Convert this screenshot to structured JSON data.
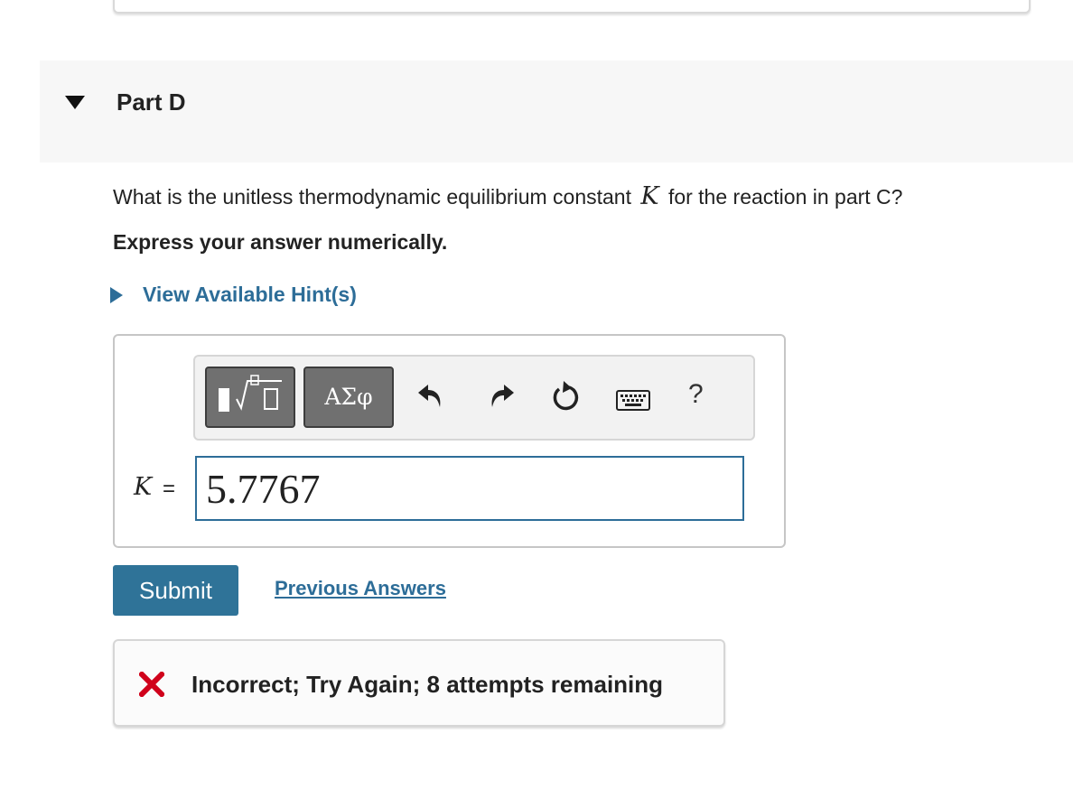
{
  "part": {
    "title": "Part D"
  },
  "question": {
    "text_before": "What is the unitless thermodynamic equilibrium constant",
    "variable": "K",
    "text_after": "for the reaction in part C?",
    "instruction": "Express your answer numerically."
  },
  "hint": {
    "label": "View Available Hint(s)"
  },
  "toolbar": {
    "greek_label": "ΑΣφ",
    "help_label": "?"
  },
  "answer": {
    "variable": "K",
    "equals": "=",
    "value": "5.7767"
  },
  "actions": {
    "submit_label": "Submit",
    "previous_answers_label": "Previous Answers"
  },
  "feedback": {
    "message": "Incorrect; Try Again; 8 attempts remaining"
  },
  "icons": {
    "collapse": "caret-down-icon",
    "hint": "caret-right-icon",
    "templates": "templates-icon",
    "undo": "undo-icon",
    "redo": "redo-icon",
    "reset": "reset-icon",
    "keyboard": "keyboard-icon",
    "incorrect": "x-mark-icon"
  },
  "colors": {
    "link": "#2d6d98",
    "submit_bg": "#2f7398",
    "error": "#d0021b",
    "header_bg": "#f7f7f7"
  }
}
